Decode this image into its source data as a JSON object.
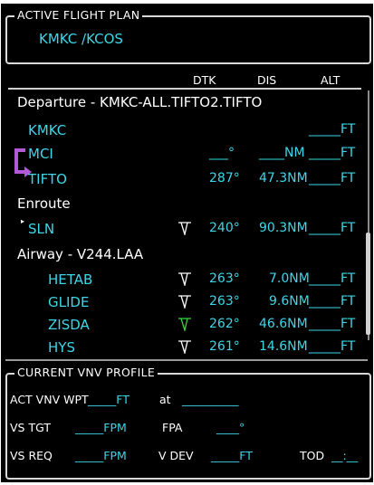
{
  "flight_plan": {
    "title": "ACTIVE FLIGHT PLAN",
    "route": "KMKC /KCOS",
    "columns": {
      "dtk": "DTK",
      "dis": "DIS",
      "alt": "ALT"
    },
    "departure_header": "Departure - KMKC-ALL.TIFTO2.TIFTO",
    "rows": [
      {
        "name": "KMKC",
        "dtk": "",
        "dis": "",
        "alt": "_____FT"
      },
      {
        "name": "MCI",
        "dtk": "___°",
        "dis": "____NM",
        "alt": "_____FT"
      },
      {
        "name": "TIFTO",
        "dtk": "287°",
        "dis": "47.3NM",
        "alt": "_____FT"
      }
    ],
    "enroute_header": "Enroute",
    "enroute_rows": [
      {
        "name": "SLN",
        "dtk": "240°",
        "dis": "90.3NM",
        "alt": "_____FT"
      }
    ],
    "airway_header": "Airway - V244.LAA",
    "airway_rows": [
      {
        "name": "HETAB",
        "dtk": "263°",
        "dis": "7.0NM",
        "alt": "_____FT"
      },
      {
        "name": "GLIDE",
        "dtk": "263°",
        "dis": "9.6NM",
        "alt": "_____FT"
      },
      {
        "name": "ZISDA",
        "dtk": "262°",
        "dis": "46.6NM",
        "alt": "_____FT"
      },
      {
        "name": "HYS",
        "dtk": "261°",
        "dis": "14.6NM",
        "alt": "_____FT"
      }
    ]
  },
  "vnv_profile": {
    "title": "CURRENT VNV PROFILE",
    "act_vnv_wpt_label": "ACT VNV WPT",
    "act_vnv_wpt_value": "_____FT",
    "at_label": "at",
    "at_value": "__________",
    "vs_tgt_label": "VS TGT",
    "vs_tgt_value": "_____FPM",
    "fpa_label": "FPA",
    "fpa_value": "____°",
    "vs_req_label": "VS REQ",
    "vs_req_value": "_____FPM",
    "v_dev_label": "V DEV",
    "v_dev_value": "_____FT",
    "tod_label": "TOD",
    "tod_value": "__:__"
  },
  "colors": {
    "cyan": "#3ed6e8",
    "magenta_active_leg": "#b25ad6",
    "vnv_symbol_white": "#ffffff",
    "vnv_symbol_active_green": "#3cd23c"
  }
}
